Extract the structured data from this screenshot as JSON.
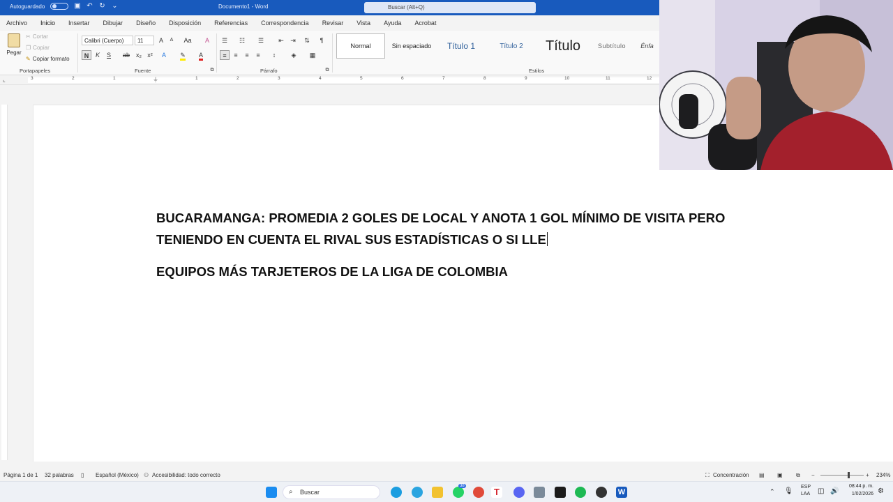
{
  "titlebar": {
    "autosave": "Autoguardado",
    "doc_title": "Documento1 - Word",
    "search_placeholder": "Buscar (Alt+Q)"
  },
  "tabs": [
    "Archivo",
    "Inicio",
    "Insertar",
    "Dibujar",
    "Diseño",
    "Disposición",
    "Referencias",
    "Correspondencia",
    "Revisar",
    "Vista",
    "Ayuda",
    "Acrobat"
  ],
  "ribbon": {
    "clipboard": {
      "paste": "Pegar",
      "cut": "Cortar",
      "copy": "Copiar",
      "format_painter": "Copiar formato",
      "label": "Portapapeles"
    },
    "font": {
      "name": "Calibri (Cuerpo)",
      "size": "11",
      "bold": "N",
      "italic": "K",
      "underline": "S",
      "strike": "ab",
      "sub": "x₂",
      "sup": "x²",
      "label": "Fuente",
      "case": "Aa"
    },
    "paragraph": {
      "label": "Párrafo"
    },
    "styles": {
      "label": "Estilos",
      "items": [
        "Normal",
        "Sin espaciado",
        "Título 1",
        "Título 2",
        "Título",
        "Subtítulo",
        "Énfa"
      ]
    }
  },
  "ruler": {
    "numbers": [
      "3",
      "2",
      "1",
      "",
      "1",
      "2",
      "3",
      "4",
      "5",
      "6",
      "7",
      "8",
      "9",
      "10",
      "11",
      "12"
    ]
  },
  "document": {
    "line1": "BUCARAMANGA: PROMEDIA 2 GOLES DE LOCAL Y ANOTA 1 GOL MÍNIMO DE VISITA PERO",
    "line2": "TENIENDO EN CUENTA EL RIVAL SUS ESTADÍSTICAS O SI LLE",
    "line3": "EQUIPOS MÁS TARJETEROS DE LA LIGA DE COLOMBIA"
  },
  "statusbar": {
    "page": "Página 1 de 1",
    "words": "32 palabras",
    "language": "Español (México)",
    "accessibility": "Accesibilidad: todo correcto",
    "focus": "Concentración",
    "zoom": "234%"
  },
  "taskbar": {
    "search": "Buscar",
    "badge": "38",
    "lang": "ESP",
    "lang2": "LAA",
    "time": "08:44 p. m.",
    "date": "1/02/2026"
  },
  "colors": {
    "accent": "#185abd"
  }
}
